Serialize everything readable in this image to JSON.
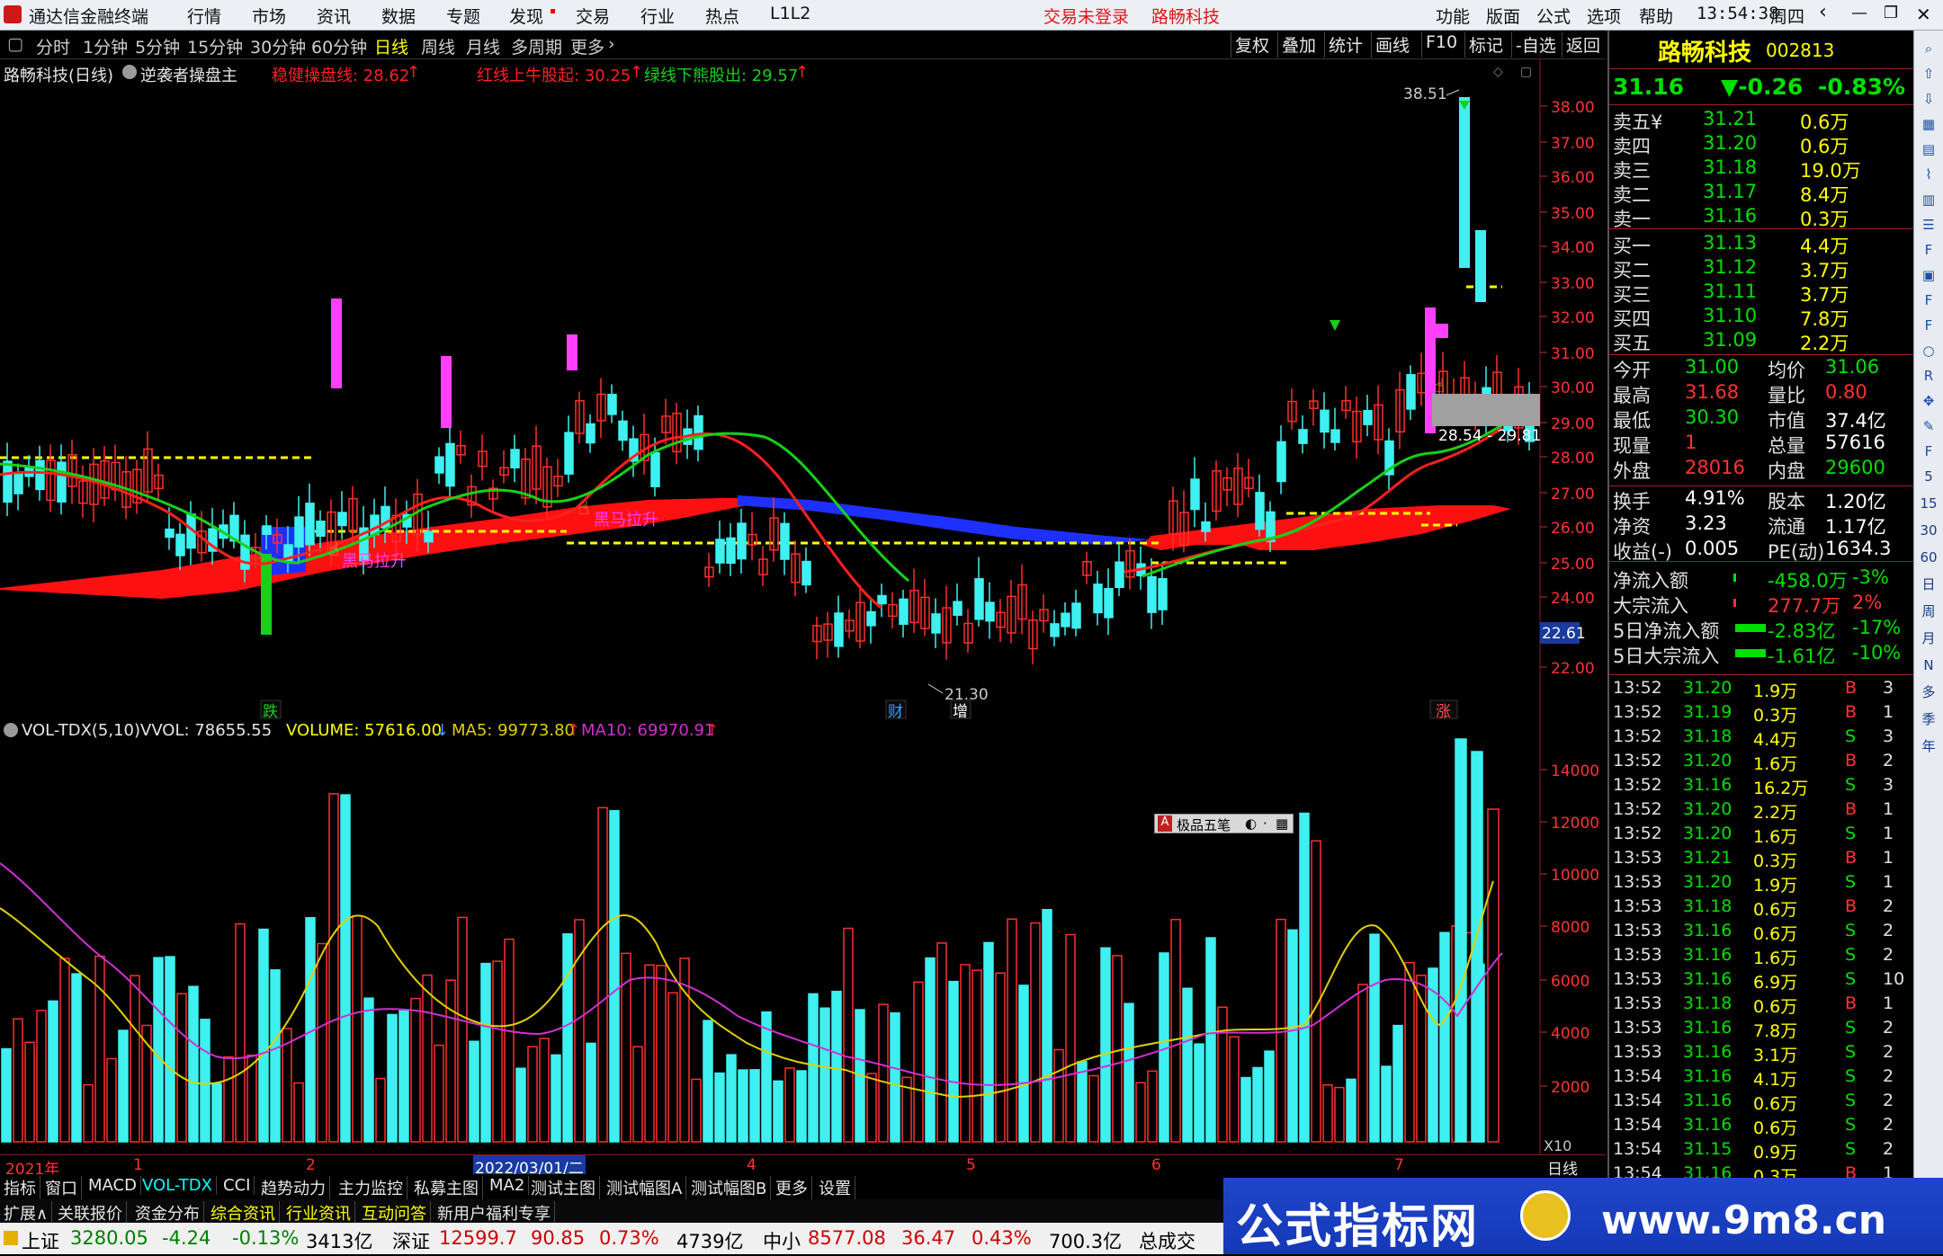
{
  "titlebar": {
    "app_name": "通达信金融终端",
    "menus": [
      "行情",
      "市场",
      "资讯",
      "数据",
      "专题",
      "发现",
      "交易",
      "行业",
      "热点",
      "L1L2"
    ],
    "notice": "交易未登录",
    "stock_title": "路畅科技",
    "right_menus": [
      "功能",
      "版面",
      "公式",
      "选项",
      "帮助"
    ],
    "time": "13:54:38",
    "weekday": "周四"
  },
  "period_tabs": {
    "items": [
      "分时",
      "1分钟",
      "5分钟",
      "15分钟",
      "30分钟",
      "60分钟",
      "日线",
      "周线",
      "月线",
      "多周期",
      "更多"
    ],
    "active": "日线"
  },
  "toolbar_buttons": [
    "复权",
    "叠加",
    "统计",
    "画线",
    "F10",
    "标记",
    "-自选",
    "返回"
  ],
  "chart_header": {
    "name": "路畅科技(日线)",
    "formula": "逆袭者操盘主",
    "line1": "稳健操盘线: 28.62",
    "line2": "红线上牛股起: 30.25",
    "line3": "绿线下熊股出: 29.57"
  },
  "price_axis": [
    "38.00",
    "37.00",
    "36.00",
    "35.00",
    "34.00",
    "33.00",
    "32.00",
    "31.00",
    "30.00",
    "29.00",
    "28.00",
    "27.00",
    "26.00",
    "25.00",
    "24.00",
    "22.00"
  ],
  "annotations": {
    "high_label": "38.51",
    "low_label": "21.30",
    "current_marker": "22.61",
    "range_label": "28.54 - 29.81",
    "signal1": "黑马拉升",
    "signal2": "黑马拉升",
    "fall_tag": "跌",
    "cai_tag": "财",
    "zeng_tag": "增",
    "zhang_tag": "涨"
  },
  "volume_header": {
    "name": "VOL-TDX(5,10)",
    "vvol": "VVOL: 78655.55",
    "volume": "VOLUME: 57616.00",
    "ma5": "MA5: 99773.80",
    "ma10": "MA10: 69970.91"
  },
  "volume_axis": [
    "14000",
    "12000",
    "10000",
    "8000",
    "6000",
    "4000",
    "2000"
  ],
  "volume_unit": "X10",
  "ime_label": "极品五笔",
  "date_axis": {
    "labels": [
      "2021年",
      "1",
      "2",
      "2022/03/01/二",
      "4",
      "5",
      "6",
      "7"
    ],
    "period": "日线"
  },
  "bottom_tabs": [
    "指标",
    "窗口",
    "MACD",
    "VOL-TDX",
    "CCI",
    "趋势动力",
    "主力监控",
    "私募主图",
    "MA2",
    "测试主图",
    "测试幅图A",
    "测试幅图B",
    "更多",
    "设置"
  ],
  "bottom_tabs_active": "VOL-TDX",
  "bottom_tabs2": [
    "扩展∧",
    "关联报价",
    "资金分布",
    "综合资讯",
    "行业资讯",
    "互动问答",
    "新用户福利专享"
  ],
  "status": {
    "sh_name": "上证",
    "sh_val": "3280.05",
    "sh_chg": "-4.24",
    "sh_pct": "-0.13%",
    "sh_amt": "3413亿",
    "sz_name": "深证",
    "sz_val": "12599.7",
    "sz_chg": "90.85",
    "sz_pct": "0.73%",
    "sz_amt": "4739亿",
    "zx_name": "中小",
    "zx_val": "8577.08",
    "zx_chg": "36.47",
    "zx_pct": "0.43%",
    "zx_amt": "700.3亿",
    "total_label": "总成交"
  },
  "quote": {
    "name": "路畅科技",
    "code": "002813",
    "price": "31.16",
    "change": "▼-0.26",
    "pct": "-0.83%",
    "asks": [
      {
        "label": "卖五¥",
        "price": "31.21",
        "vol": "0.6万"
      },
      {
        "label": "卖四",
        "price": "31.20",
        "vol": "0.6万"
      },
      {
        "label": "卖三",
        "price": "31.18",
        "vol": "19.0万"
      },
      {
        "label": "卖二",
        "price": "31.17",
        "vol": "8.4万"
      },
      {
        "label": "卖一",
        "price": "31.16",
        "vol": "0.3万"
      }
    ],
    "bids": [
      {
        "label": "买一",
        "price": "31.13",
        "vol": "4.4万"
      },
      {
        "label": "买二",
        "price": "31.12",
        "vol": "3.7万"
      },
      {
        "label": "买三",
        "price": "31.11",
        "vol": "3.7万"
      },
      {
        "label": "买四",
        "price": "31.10",
        "vol": "7.8万"
      },
      {
        "label": "买五",
        "price": "31.09",
        "vol": "2.2万"
      }
    ],
    "stats": [
      {
        "l1": "今开",
        "v1": "31.00",
        "l2": "均价",
        "v2": "31.06"
      },
      {
        "l1": "最高",
        "v1": "31.68",
        "l2": "量比",
        "v2": "0.80"
      },
      {
        "l1": "最低",
        "v1": "30.30",
        "l2": "市值",
        "v2": "37.4亿"
      },
      {
        "l1": "现量",
        "v1": "1",
        "l2": "总量",
        "v2": "57616"
      },
      {
        "l1": "外盘",
        "v1": "28016",
        "l2": "内盘",
        "v2": "29600"
      }
    ],
    "stats2": [
      {
        "l1": "换手",
        "v1": "4.91%",
        "l2": "股本",
        "v2": "1.20亿"
      },
      {
        "l1": "净资",
        "v1": "3.23",
        "l2": "流通",
        "v2": "1.17亿"
      },
      {
        "l1": "收益(-)",
        "v1": "0.005",
        "l2": "PE(动)",
        "v2": "1634.3"
      }
    ],
    "flows": [
      {
        "label": "净流入额",
        "val": "-458.0万",
        "pct": "-3%"
      },
      {
        "label": "大宗流入",
        "val": "277.7万",
        "pct": "2%"
      },
      {
        "label": "5日净流入额",
        "val": "-2.83亿",
        "pct": "-17%"
      },
      {
        "label": "5日大宗流入",
        "val": "-1.61亿",
        "pct": "-10%"
      }
    ],
    "ticks": [
      [
        "13:52",
        "31.20",
        "1.9万",
        "B",
        "3"
      ],
      [
        "13:52",
        "31.19",
        "0.3万",
        "B",
        "1"
      ],
      [
        "13:52",
        "31.18",
        "4.4万",
        "S",
        "3"
      ],
      [
        "13:52",
        "31.20",
        "1.6万",
        "B",
        "2"
      ],
      [
        "13:52",
        "31.16",
        "16.2万",
        "S",
        "3"
      ],
      [
        "13:52",
        "31.20",
        "2.2万",
        "B",
        "1"
      ],
      [
        "13:52",
        "31.20",
        "1.6万",
        "S",
        "1"
      ],
      [
        "13:53",
        "31.21",
        "0.3万",
        "B",
        "1"
      ],
      [
        "13:53",
        "31.20",
        "1.9万",
        "S",
        "1"
      ],
      [
        "13:53",
        "31.18",
        "0.6万",
        "B",
        "2"
      ],
      [
        "13:53",
        "31.16",
        "0.6万",
        "S",
        "2"
      ],
      [
        "13:53",
        "31.16",
        "1.6万",
        "S",
        "2"
      ],
      [
        "13:53",
        "31.16",
        "6.9万",
        "S",
        "10"
      ],
      [
        "13:53",
        "31.18",
        "0.6万",
        "B",
        "1"
      ],
      [
        "13:53",
        "31.16",
        "7.8万",
        "S",
        "2"
      ],
      [
        "13:53",
        "31.16",
        "3.1万",
        "S",
        "2"
      ],
      [
        "13:54",
        "31.16",
        "4.1万",
        "S",
        "2"
      ],
      [
        "13:54",
        "31.16",
        "0.6万",
        "S",
        "2"
      ],
      [
        "13:54",
        "31.16",
        "0.6万",
        "S",
        "2"
      ],
      [
        "13:54",
        "31.15",
        "0.9万",
        "S",
        "2"
      ],
      [
        "13:54",
        "31.16",
        "0.3万",
        "B",
        "1"
      ]
    ]
  },
  "sidebar_icons": [
    "search-icon",
    "arrow-up-icon",
    "arrow-down-icon",
    "chart-icon",
    "grid-icon",
    "line-chart-icon",
    "candle-icon",
    "list-icon",
    "f10-icon",
    "doc-icon",
    "f2-icon",
    "f3-icon",
    "circle-icon",
    "rsi-icon",
    "move-icon",
    "pen-icon",
    "fs-icon"
  ],
  "sidebar_labels": [
    "5",
    "15",
    "30",
    "60",
    "日",
    "周",
    "月",
    "N",
    "多",
    "季",
    "年"
  ],
  "banner": {
    "text": "公式指标网",
    "url": "www.9m8.cn"
  }
}
